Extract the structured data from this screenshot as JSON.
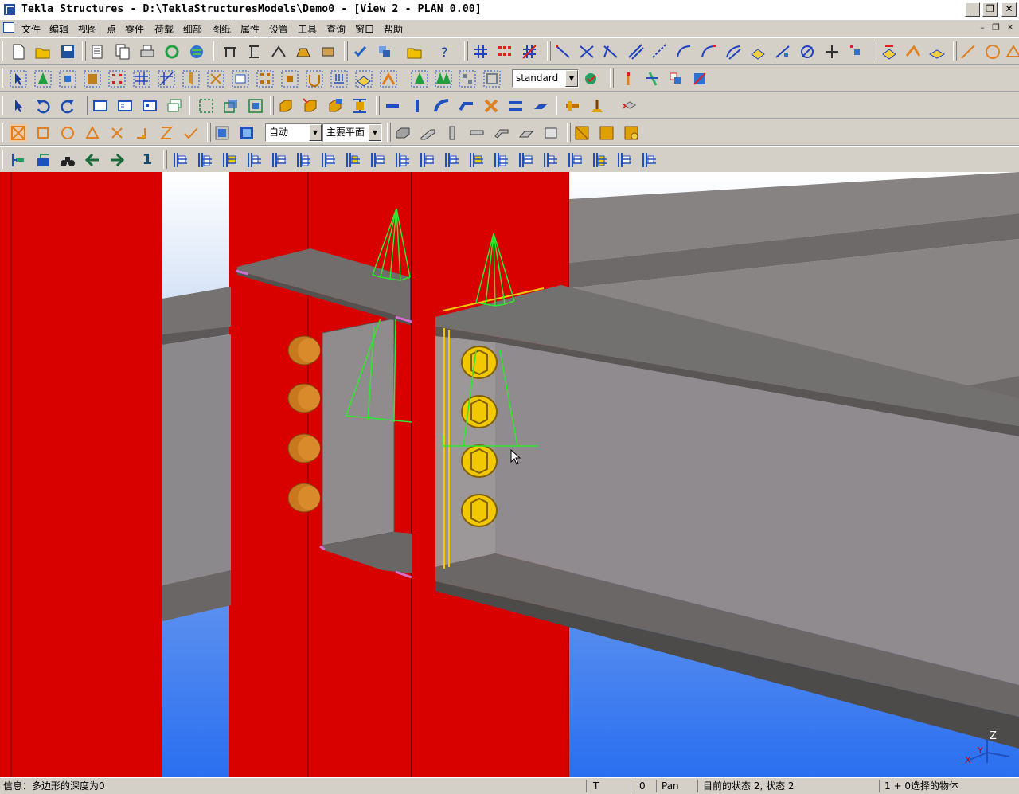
{
  "window": {
    "title": "Tekla Structures - D:\\TeklaStructuresModels\\Demo0 - [View 2 - PLAN 0.00]",
    "minimize_glyph": "_",
    "maximize_glyph": "❐",
    "close_glyph": "✕"
  },
  "menu": {
    "items": [
      "文件",
      "编辑",
      "视图",
      "点",
      "零件",
      "荷载",
      "细部",
      "图纸",
      "属性",
      "设置",
      "工具",
      "查询",
      "窗口",
      "帮助"
    ]
  },
  "toolbars": {
    "filter_combo": "standard",
    "snap_depth_combo": "自动",
    "plane_combo": "主要平面",
    "step_number": "1"
  },
  "status": {
    "message": "信息：多边形的深度为0",
    "mode_t": "T",
    "value_zero": "0",
    "pan": "Pan",
    "state": "目前的状态 2, 状态 2",
    "selection": "1 + 0选择的物体"
  },
  "view": {
    "axis_labels": [
      "Z",
      "Y",
      "X"
    ]
  },
  "colors": {
    "column_red": "#d90000",
    "beam_gray": "#8c898c",
    "bolt_orange": "#c8781e",
    "bolt_selected_yellow": "#f2c800",
    "selection_green": "#2ee82e",
    "sky_blue": "#3a80f0"
  }
}
